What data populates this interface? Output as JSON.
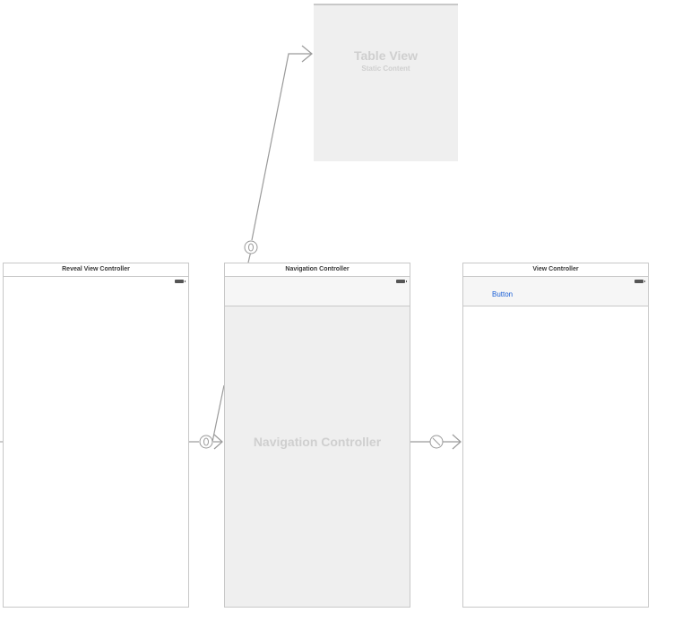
{
  "scenes": {
    "table_view": {
      "title": "Table View",
      "subtitle": "Static Content"
    },
    "reveal": {
      "title": "Reveal View Controller"
    },
    "navigation": {
      "title": "Navigation Controller",
      "placeholder": "Navigation Controller"
    },
    "view_controller": {
      "title": "View Controller",
      "button_label": "Button"
    }
  },
  "colors": {
    "scene_border": "#c8c8c8",
    "placeholder_bg": "#efefef",
    "placeholder_text": "#cfcfcf",
    "segue_line": "#9a9a9a",
    "button_text": "#1a5fd6"
  },
  "segues": [
    {
      "from": "navigation",
      "to": "table_view",
      "icon": "relationship-segue-icon"
    },
    {
      "from": "reveal",
      "to": "navigation",
      "icon": "relationship-segue-icon"
    },
    {
      "from": "navigation",
      "to": "view_controller",
      "icon": "root-view-segue-icon"
    }
  ]
}
